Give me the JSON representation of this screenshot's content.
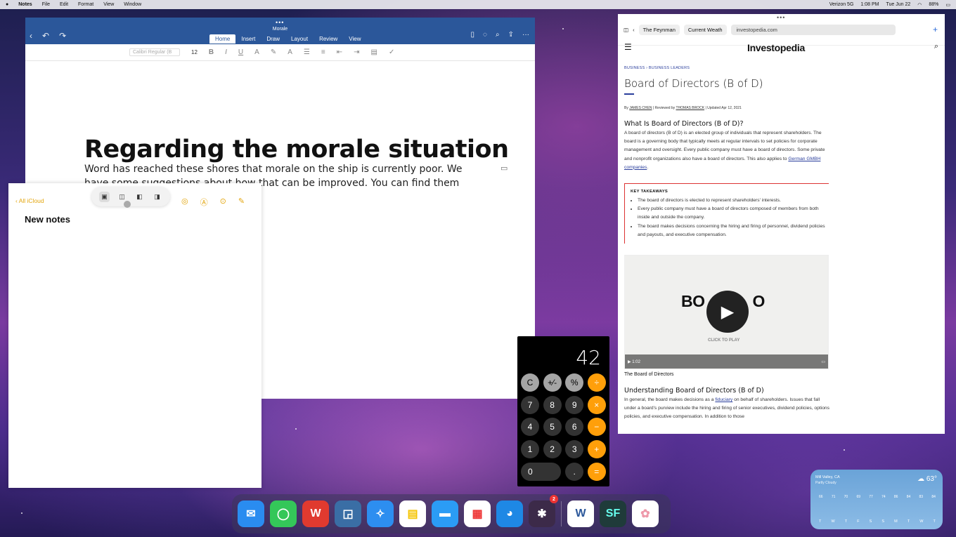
{
  "menubar": {
    "app": "Notes",
    "items": [
      "File",
      "Edit",
      "Format",
      "View",
      "Window"
    ],
    "carrier": "Verizon 5G",
    "time": "1:08 PM",
    "date": "Tue Jun 22",
    "battery": "88%"
  },
  "word": {
    "doc_title": "Morale",
    "tabs": [
      "Home",
      "Insert",
      "Draw",
      "Layout",
      "Review",
      "View"
    ],
    "font": "Calibri Regular (B",
    "size": "12",
    "heading": "Regarding the morale situation",
    "body1": "Word has reached these shores that morale on the ship is currently poor. We",
    "body2": "have some suggestions about how that can be improved. You can find them"
  },
  "notes": {
    "back": "All iCloud",
    "title": "New notes"
  },
  "calc": {
    "display": "42",
    "keys": [
      "C",
      "+⁄-",
      "%",
      "÷",
      "7",
      "8",
      "9",
      "×",
      "4",
      "5",
      "6",
      "−",
      "1",
      "2",
      "3",
      "+",
      "0",
      ".",
      "="
    ]
  },
  "safari": {
    "tab1": "The Feynman",
    "tab2": "Current Weath",
    "url": "investopedia.com",
    "logo": "Investopedia",
    "crumb1": "BUSINESS",
    "crumb2": "BUSINESS LEADERS",
    "title": "Board of Directors (B of D)",
    "by": "By",
    "author": "JAMES CHEN",
    "reviewed": "Reviewed by",
    "reviewer": "THOMAS BROCK",
    "updated": "Updated Apr 12, 2021",
    "h_what": "What Is Board of Directors (B of D)?",
    "p_what": "A board of directors (B of D) is an elected group of individuals that represent shareholders. The board is a governing body that typically meets at regular intervals to set policies for corporate management and oversight. Every public company must have a board of directors. Some private and nonprofit organizations also have a board of directors. This also applies to",
    "p_link": "German GMBH companies",
    "kt_head": "KEY TAKEAWAYS",
    "kt": [
      "The board of directors is elected to represent shareholders' interests.",
      "Every public company must have a board of directors composed of members from both inside and outside the company.",
      "The board makes decisions concerning the hiring and firing of personnel, dividend policies and payouts, and executive compensation."
    ],
    "video_text1": "BO",
    "video_text2": "O",
    "video_click": "CLICK TO PLAY",
    "video_time": "1:02",
    "video_caption": "The Board of Directors",
    "h_under": "Understanding Board of Directors (B of D)",
    "p_under1": "In general, the board makes decisions as a",
    "p_under_link": "fiduciary",
    "p_under2": "on behalf of shareholders. Issues that fall under a board's purview include the hiring and firing of senior executives, dividend policies, options policies, and executive compensation. In addition to those"
  },
  "dock": {
    "apps": [
      "Mail",
      "Messages",
      "WPS",
      "Screens",
      "Safari",
      "Notes",
      "Files",
      "Fantastical",
      "Tweetbot",
      "Slack",
      "Word",
      "SF",
      "Photos"
    ],
    "slack_badge": "2"
  },
  "weather": {
    "location": "Mill Valley, CA",
    "condition": "Partly Cloudy",
    "temp": "63°",
    "temps": [
      "66",
      "71",
      "70",
      "69",
      "77",
      "74",
      "86",
      "84",
      "83",
      "84"
    ],
    "days": [
      "T",
      "W",
      "T",
      "F",
      "S",
      "S",
      "M",
      "T",
      "W",
      "T"
    ]
  }
}
